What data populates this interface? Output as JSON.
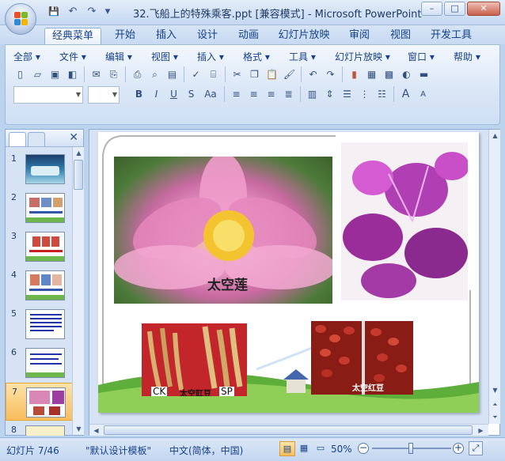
{
  "window": {
    "title": "32.飞船上的特殊乘客.ppt [兼容模式] - Microsoft PowerPoint",
    "minimize": "–",
    "maximize": "□",
    "close": "✕"
  },
  "quick_access": {
    "save": "💾",
    "undo": "↶",
    "redo": "↷",
    "more": "▾"
  },
  "ribbon_tabs": [
    "经典菜单",
    "开始",
    "插入",
    "设计",
    "动画",
    "幻灯片放映",
    "审阅",
    "视图",
    "开发工具"
  ],
  "menus": [
    "全部 ▾",
    "文件 ▾",
    "编辑 ▾",
    "视图 ▾",
    "插入 ▾",
    "格式 ▾",
    "工具 ▾",
    "幻灯片放映 ▾",
    "窗口 ▾",
    "帮助 ▾"
  ],
  "format_buttons": {
    "bold": "B",
    "italic": "I",
    "underline": "U",
    "strike": "S",
    "case": "Aa",
    "grow": "A",
    "shrink": "A"
  },
  "slides": {
    "items": [
      "1",
      "2",
      "3",
      "4",
      "5",
      "6",
      "7",
      "8"
    ],
    "selected": "7"
  },
  "slide_content": {
    "photo1_caption": "太空莲",
    "photo3_caption": "太空豇豆",
    "photo3_label_left": "CK",
    "photo3_label_right": "SP",
    "photo4_caption": "太空红豆"
  },
  "status": {
    "slide_counter": "幻灯片 7/46",
    "template": "\"默认设计模板\"",
    "language": "中文(简体，中国)",
    "zoom": "50%"
  },
  "colors": {
    "accent": "#15428b",
    "selected_tab": "#f9bd5c"
  }
}
